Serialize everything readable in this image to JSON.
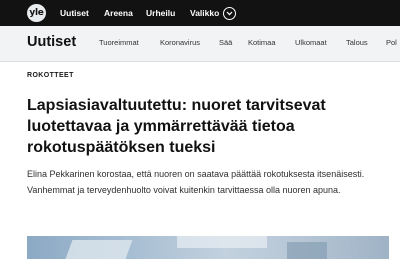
{
  "topbar": {
    "logo_text": "yle",
    "nav": [
      {
        "label": "Uutiset"
      },
      {
        "label": "Areena"
      },
      {
        "label": "Urheilu"
      },
      {
        "label": "Valikko"
      }
    ]
  },
  "section": {
    "title": "Uutiset",
    "links": [
      {
        "label": "Tuoreimmat"
      },
      {
        "label": "Koronavirus"
      },
      {
        "label": "Sää"
      },
      {
        "label": "Kotimaa"
      },
      {
        "label": "Ulkomaat"
      },
      {
        "label": "Talous"
      },
      {
        "label": "Pol"
      }
    ]
  },
  "article": {
    "kicker": "ROKOTTEET",
    "headline": "Lapsiasiavaltuutettu: nuoret tarvitsevat luotettavaa ja ymmärrettävää tietoa rokotuspäätöksen tueksi",
    "lead": "Elina Pekkarinen korostaa, että nuoren on saatava päättää rokotuksesta itsenäisesti. Vanhemmat ja terveydenhuolto voivat kuitenkin tarvittaessa olla nuoren apuna."
  },
  "colors": {
    "topbar_bg": "#121212",
    "section_bg": "#f1f3f4"
  },
  "icons": {
    "menu_chevron": "chevron-down-icon"
  }
}
